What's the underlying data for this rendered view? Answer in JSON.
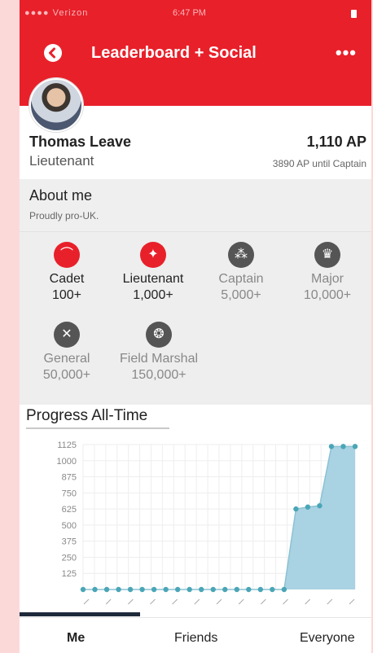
{
  "status": {
    "carrier": "●●●● Verizon",
    "time": "6:47 PM"
  },
  "header": {
    "title": "Leaderboard + Social",
    "back_icon": "back-arrow-icon",
    "more_icon": "more-dots-icon",
    "more_label": "•••"
  },
  "profile": {
    "name": "Thomas Leave",
    "rank": "Lieutenant",
    "points": "1,110 AP",
    "until_next": "3890 AP until Captain"
  },
  "about": {
    "title": "About me",
    "text": "Proudly pro-UK."
  },
  "badges": [
    {
      "name": "Cadet",
      "threshold": "100+",
      "achieved": true,
      "icon": "cap-icon"
    },
    {
      "name": "Lieutenant",
      "threshold": "1,000+",
      "achieved": true,
      "icon": "single-star-icon"
    },
    {
      "name": "Captain",
      "threshold": "5,000+",
      "achieved": false,
      "icon": "three-stars-icon"
    },
    {
      "name": "Major",
      "threshold": "10,000+",
      "achieved": false,
      "icon": "crown-icon"
    },
    {
      "name": "General",
      "threshold": "50,000+",
      "achieved": false,
      "icon": "crossed-swords-icon"
    },
    {
      "name": "Field Marshal",
      "threshold": "150,000+",
      "achieved": false,
      "icon": "wreath-icon"
    }
  ],
  "progress": {
    "title": "Progress All-Time"
  },
  "chart_data": {
    "type": "area",
    "title": "Progress All-Time",
    "y_ticks": [
      "1125",
      "1000",
      "875",
      "750",
      "625",
      "500",
      "375",
      "250",
      "125"
    ],
    "ylim": [
      0,
      1125
    ],
    "values": [
      0,
      0,
      0,
      0,
      0,
      0,
      0,
      0,
      0,
      0,
      0,
      0,
      0,
      0,
      0,
      0,
      0,
      0,
      625,
      640,
      650,
      1110,
      1110,
      1110
    ],
    "grid": true,
    "color": "#a9d2e3",
    "point_color": "#4aa6b6"
  },
  "tabs": [
    {
      "label": "Me",
      "active": true
    },
    {
      "label": "Friends",
      "active": false
    },
    {
      "label": "Everyone",
      "active": false
    }
  ]
}
